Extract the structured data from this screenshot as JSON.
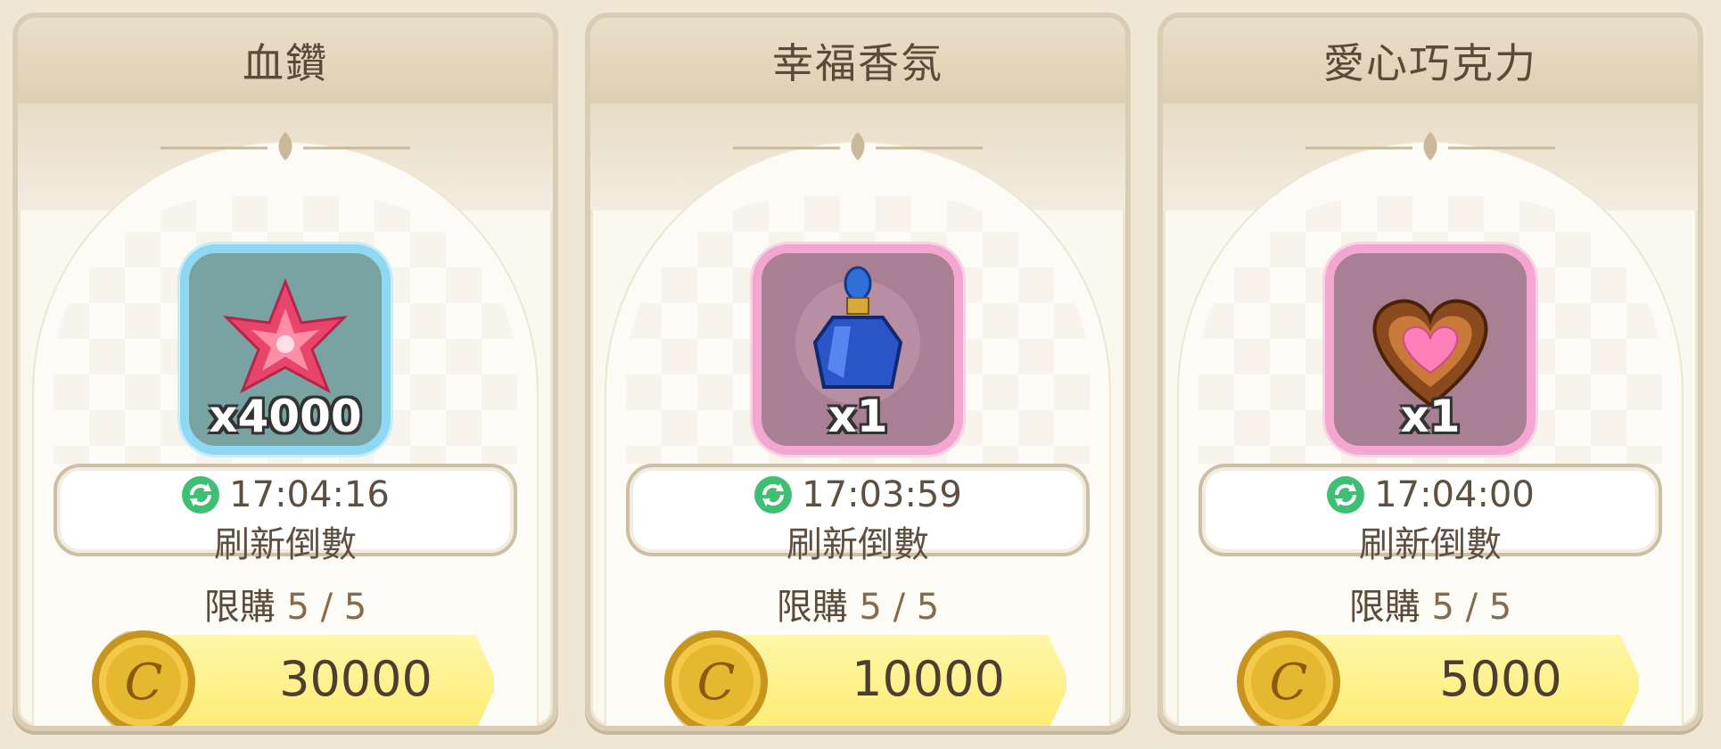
{
  "cards": [
    {
      "title": "血鑽",
      "item_icon": "red-gem-icon",
      "frame_color": "#8fd8f2",
      "quantity": "x4000",
      "timer": "17:04:16",
      "refresh_label": "刷新倒數",
      "limit_label": "限購",
      "limit_count": "5 / 5",
      "price": "30000"
    },
    {
      "title": "幸福香氛",
      "item_icon": "perfume-bottle-icon",
      "frame_color": "#f3a6cf",
      "quantity": "x1",
      "timer": "17:03:59",
      "refresh_label": "刷新倒數",
      "limit_label": "限購",
      "limit_count": "5 / 5",
      "price": "10000"
    },
    {
      "title": "愛心巧克力",
      "item_icon": "heart-chocolate-icon",
      "frame_color": "#f3a6cf",
      "quantity": "x1",
      "timer": "17:04:00",
      "refresh_label": "刷新倒數",
      "limit_label": "限購",
      "limit_count": "5 / 5",
      "price": "5000"
    }
  ],
  "colors": {
    "price_bar": "#fdec74",
    "coin": "#e6b830",
    "refresh_icon": "#3fbf73"
  }
}
